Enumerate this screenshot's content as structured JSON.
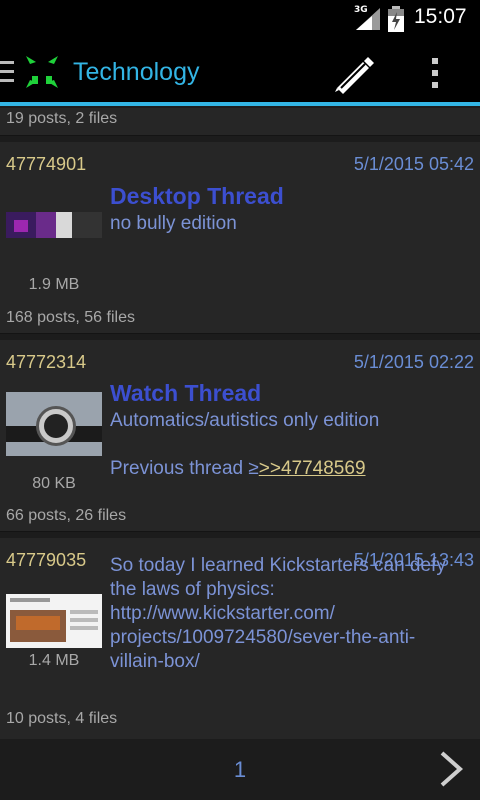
{
  "status": {
    "network": "3G",
    "time": "15:07"
  },
  "header": {
    "title": "Technology",
    "compose_icon": "pencil-icon",
    "menu_icon": "overflow-menu-icon"
  },
  "colors": {
    "accent": "#33b5e5",
    "post_number": "#d8c98a",
    "subject": "#3c4fd0",
    "comment": "#7c93d6"
  },
  "threads": [
    {
      "stats": "19 posts, 2 files"
    },
    {
      "number": "47774901",
      "date": "5/1/2015 05:42",
      "subject": "Desktop Thread",
      "comment": "no bully edition",
      "filesize": "1.9 MB",
      "stats": "168 posts, 56 files"
    },
    {
      "number": "47772314",
      "date": "5/1/2015 02:22",
      "subject": "Watch Thread",
      "comment": "Automatics/autistics only edition",
      "comment_prefix": "Previous thread ≥",
      "quote_link": ">>47748569",
      "filesize": "80 KB",
      "stats": "66 posts, 26 files"
    },
    {
      "number": "47779035",
      "date": "5/1/2015 13:43",
      "comment": "So today I learned Kickstarters can defy the laws of physics:",
      "link_lines": [
        "http://www.kickstarter.com/",
        "projects/1009724580/sever-the-anti-",
        "villain-box/"
      ],
      "filesize": "1.4 MB",
      "stats": "10 posts, 4 files"
    }
  ],
  "pagination": {
    "current_page": "1"
  }
}
